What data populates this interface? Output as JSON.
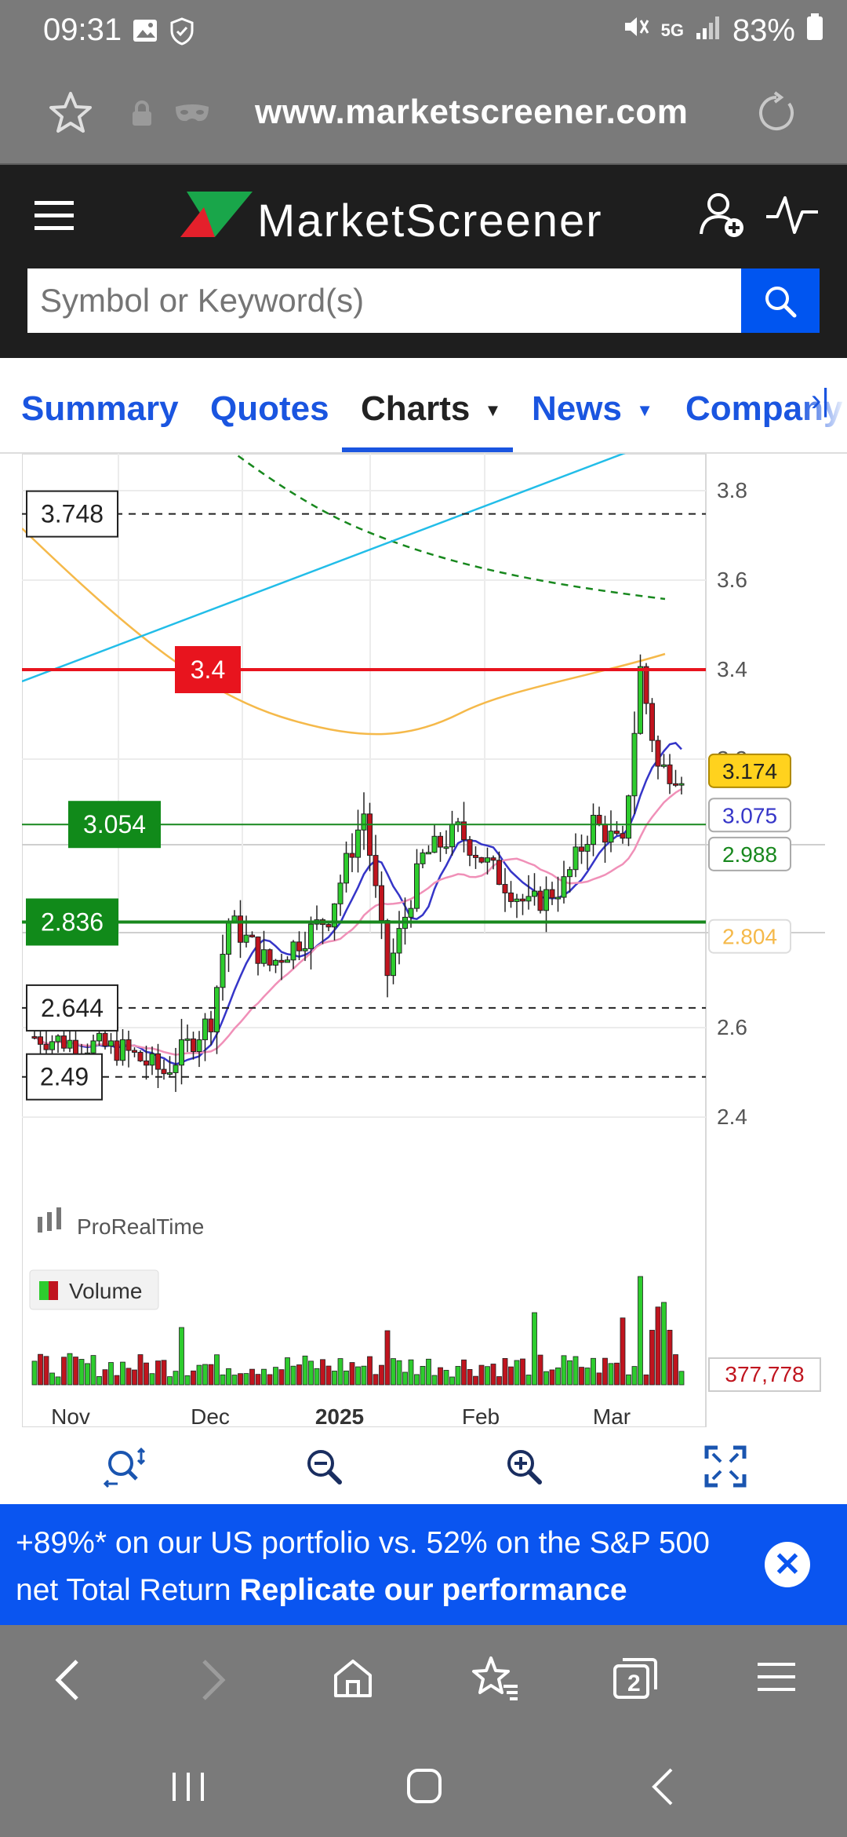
{
  "status": {
    "time": "09:31",
    "battery": "83%",
    "network": "5G"
  },
  "browser": {
    "url": "www.marketscreener.com",
    "tab_count": "2"
  },
  "site": {
    "brand": "MarketScreener",
    "search_placeholder": "Symbol or Keyword(s)"
  },
  "tabs": [
    {
      "label": "Summary",
      "active": false
    },
    {
      "label": "Quotes",
      "active": false
    },
    {
      "label": "Charts",
      "active": true
    },
    {
      "label": "News",
      "active": false
    },
    {
      "label": "Company",
      "active": false
    }
  ],
  "chart": {
    "watermark": "ProRealTime",
    "volume_legend": "Volume",
    "volume_value": "377,778",
    "x_labels": [
      "Nov",
      "Dec",
      "2025",
      "Feb",
      "Mar"
    ],
    "y_ticks": [
      "3.8",
      "3.6",
      "3.4",
      "3.2",
      "2.6",
      "2.4"
    ],
    "levels": {
      "resistance": "3.4",
      "upper": "3.748",
      "l1": "3.054",
      "l2": "2.836",
      "l3": "2.644",
      "l4": "2.49"
    },
    "price_tags": {
      "last": "3.174",
      "ma_blue": "3.075",
      "ma_green": "2.988",
      "ma_orange": "2.804"
    },
    "colors": {
      "up": "#2ecc2e",
      "down": "#c0141e",
      "resistance": "#e8141e",
      "support": "#18881e",
      "trend": "#22bde8",
      "ma_blue": "#3535c8",
      "ma_pink": "#f090b8",
      "ma_orange": "#f5b94a",
      "last_tag": "#ffd21e"
    }
  },
  "chart_data": {
    "type": "candlestick",
    "x_labels": [
      "Nov",
      "Dec",
      "2025",
      "Feb",
      "Mar"
    ],
    "y_ticks": [
      2.4,
      2.6,
      3.2,
      3.4,
      3.6,
      3.8
    ],
    "ylim": [
      2.37,
      3.84
    ],
    "last_price": 3.174,
    "horizontal_levels": [
      3.748,
      3.4,
      3.054,
      2.836,
      2.644,
      2.49
    ],
    "moving_average_tags": [
      3.075,
      2.988,
      2.804
    ],
    "volume_last": 377778
  },
  "promo": {
    "text": "+89%* on our US portfolio vs. 52% on the S&P 500 net Total Return ",
    "link": "Replicate our performance"
  }
}
